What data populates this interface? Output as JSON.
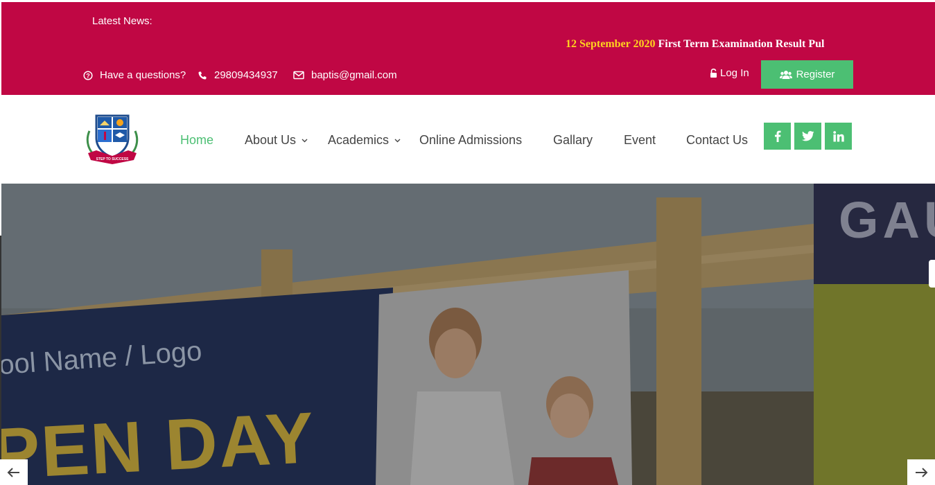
{
  "topbar": {
    "news_label": "Latest News:",
    "news_date": "12 September 2020",
    "news_text": " First Term Examination Result Pul",
    "question": "Have a questions?",
    "phone": "29809434937",
    "email": "baptis@gmail.com",
    "login": "Log In",
    "register": "Register"
  },
  "nav": {
    "items": [
      {
        "label": "Home"
      },
      {
        "label": "About Us"
      },
      {
        "label": "Academics"
      },
      {
        "label": "Online Admissions"
      },
      {
        "label": "Gallary"
      },
      {
        "label": "Event"
      },
      {
        "label": "Contact Us"
      }
    ],
    "social": [
      "facebook-icon",
      "twitter-icon",
      "linkedin-icon"
    ]
  },
  "hero": {
    "banner_line1": "ool Name / Logo",
    "banner_line2": "PEN DAY",
    "side_text": "GAUT"
  },
  "colors": {
    "topbar_bg": "#c00744",
    "accent_green": "#4cbf73",
    "news_date": "#ffd21f",
    "nav_text": "#444444"
  }
}
